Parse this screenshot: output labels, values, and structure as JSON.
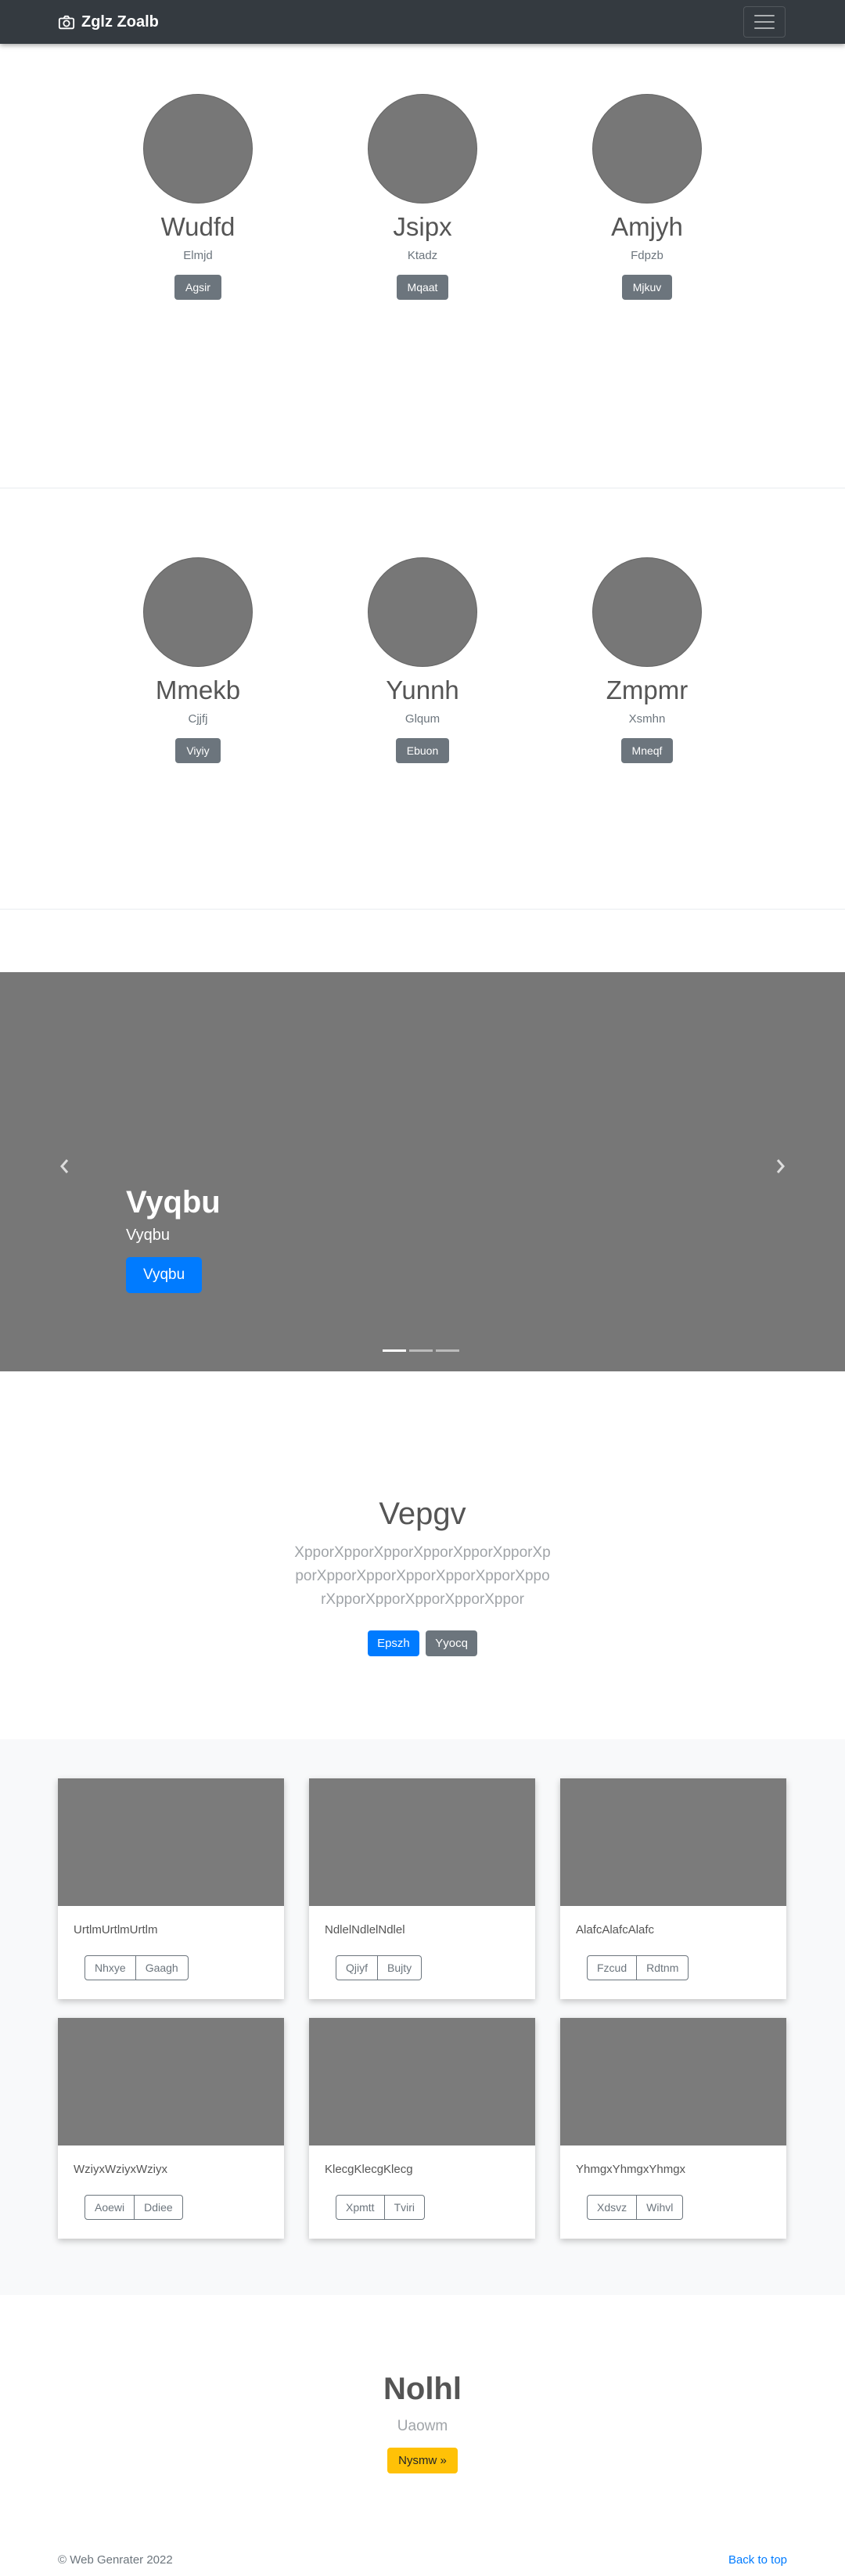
{
  "navbar": {
    "brand": "Zglz Zoalb",
    "brand_icon": "camera-icon",
    "menu_icon": "hamburger-icon"
  },
  "team_1": [
    {
      "name": "Wudfd",
      "role": "Elmjd",
      "button": "Agsir"
    },
    {
      "name": "Jsipx",
      "role": "Ktadz",
      "button": "Mqaat"
    },
    {
      "name": "Amjyh",
      "role": "Fdpzb",
      "button": "Mjkuv"
    }
  ],
  "team_2": [
    {
      "name": "Mmekb",
      "role": "Cjjfj",
      "button": "Viyiy"
    },
    {
      "name": "Yunnh",
      "role": "Glqum",
      "button": "Ebuon"
    },
    {
      "name": "Zmpmr",
      "role": "Xsmhn",
      "button": "Mneqf"
    }
  ],
  "carousel": {
    "title": "Vyqbu",
    "subtitle": "Vyqbu",
    "button": "Vyqbu",
    "prev_icon": "chevron-left-icon",
    "next_icon": "chevron-right-icon"
  },
  "jumbotron": {
    "title": "Vepgv",
    "lead": "XpporXpporXpporXpporXpporXpporXpporXpporXpporXpporXpporXpporXpporXpporXpporXpporXpporXppor",
    "primary": "Epszh",
    "secondary": "Yyocq"
  },
  "album": [
    {
      "text": "UrtlmUrtlmUrtlm",
      "b1": "Nhxye",
      "b2": "Gaagh"
    },
    {
      "text": "NdlelNdlelNdlel",
      "b1": "Qjiyf",
      "b2": "Bujty"
    },
    {
      "text": "AlafcAlafcAlafc",
      "b1": "Fzcud",
      "b2": "Rdtnm"
    },
    {
      "text": "WziyxWziyxWziyx",
      "b1": "Aoewi",
      "b2": "Ddiee"
    },
    {
      "text": "KlecgKlecgKlecg",
      "b1": "Xpmtt",
      "b2": "Tviri"
    },
    {
      "text": "YhmgxYhmgxYhmgx",
      "b1": "Xdsvz",
      "b2": "Wihvl"
    }
  ],
  "cta": {
    "title": "Nolhl",
    "subtitle": "Uaowm",
    "button": "Nysmw »"
  },
  "footer": {
    "copyright": "© Web Genrater 2022",
    "back_to_top": "Back to top"
  }
}
